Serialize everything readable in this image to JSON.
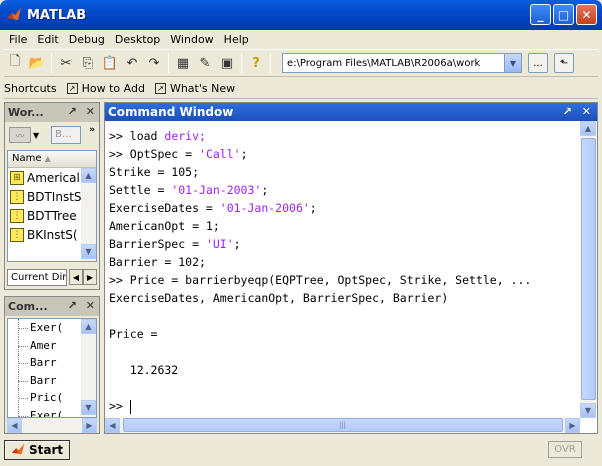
{
  "window": {
    "title": "MATLAB"
  },
  "menu": [
    "File",
    "Edit",
    "Debug",
    "Desktop",
    "Window",
    "Help"
  ],
  "toolbar": {
    "current_directory": "e:\\Program Files\\MATLAB\\R2006a\\work",
    "browse_label": "..."
  },
  "shortcuts": {
    "label": "Shortcuts",
    "items": [
      "How to Add",
      "What's New"
    ]
  },
  "workspace": {
    "title": "Wor...",
    "search_placeholder": "B...",
    "column_header": "Name",
    "items": [
      "Americal",
      "BDTInstS",
      "BDTTree",
      "BKInstS("
    ],
    "tab_label": "Current Dir"
  },
  "history": {
    "title": "Com...",
    "items": [
      "Exer(",
      "Amer",
      "Barr",
      "Barr",
      "Pric(",
      "Exer("
    ]
  },
  "command_window": {
    "title": "Command Window",
    "lines": [
      [
        {
          "t": ">> load "
        },
        {
          "t": "deriv;",
          "s": 1
        }
      ],
      [
        {
          "t": ">> OptSpec = "
        },
        {
          "t": "'Call'",
          "s": 1
        },
        {
          "t": ";"
        }
      ],
      [
        {
          "t": "Strike = 105;"
        }
      ],
      [
        {
          "t": "Settle = "
        },
        {
          "t": "'01-Jan-2003'",
          "s": 1
        },
        {
          "t": ";"
        }
      ],
      [
        {
          "t": "ExerciseDates = "
        },
        {
          "t": "'01-Jan-2006'",
          "s": 1
        },
        {
          "t": ";"
        }
      ],
      [
        {
          "t": "AmericanOpt = 1;"
        }
      ],
      [
        {
          "t": "BarrierSpec = "
        },
        {
          "t": "'UI'",
          "s": 1
        },
        {
          "t": ";"
        }
      ],
      [
        {
          "t": "Barrier = 102;"
        }
      ],
      [
        {
          "t": ">> Price = barrierbyeqp(EQPTree, OptSpec, Strike, Settle, ..."
        }
      ],
      [
        {
          "t": "ExerciseDates, AmericanOpt, BarrierSpec, Barrier)"
        }
      ],
      [
        {
          "t": ""
        }
      ],
      [
        {
          "t": "Price ="
        }
      ],
      [
        {
          "t": ""
        }
      ],
      [
        {
          "t": "   12.2632"
        }
      ],
      [
        {
          "t": ""
        }
      ],
      [
        {
          "t": ">> "
        }
      ]
    ]
  },
  "status": {
    "start_label": "Start",
    "ovr_label": "OVR"
  }
}
